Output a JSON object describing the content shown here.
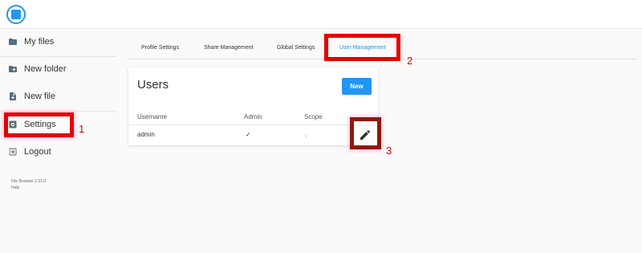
{
  "app": {
    "logo_icon": "file-browser-logo-icon"
  },
  "sidebar": {
    "items": [
      {
        "label": "My files",
        "icon": "folder-icon"
      },
      {
        "label": "New folder",
        "icon": "create-new-folder-icon"
      },
      {
        "label": "New file",
        "icon": "note-add-icon"
      },
      {
        "label": "Settings",
        "icon": "settings-applications-icon"
      },
      {
        "label": "Logout",
        "icon": "exit-to-app-icon"
      }
    ],
    "version": "File Browser 2.21.0",
    "help": "Help"
  },
  "tabs": [
    {
      "label": "Profile Settings",
      "active": false
    },
    {
      "label": "Share Management",
      "active": false
    },
    {
      "label": "Global Settings",
      "active": false
    },
    {
      "label": "User Management",
      "active": true
    }
  ],
  "users_card": {
    "title": "Users",
    "new_button": "New",
    "columns": [
      "Username",
      "Admin",
      "Scope"
    ],
    "rows": [
      {
        "username": "admin",
        "admin": "✓",
        "scope": ".",
        "edit_icon": "pencil-edit-icon"
      }
    ]
  },
  "annotations": [
    {
      "number": "1",
      "target": "Settings"
    },
    {
      "number": "2",
      "target": "User Management"
    },
    {
      "number": "3",
      "target": "edit"
    }
  ],
  "colors": {
    "accent": "#2196f3",
    "highlight": "#e60000",
    "icon": "#546e7a"
  }
}
